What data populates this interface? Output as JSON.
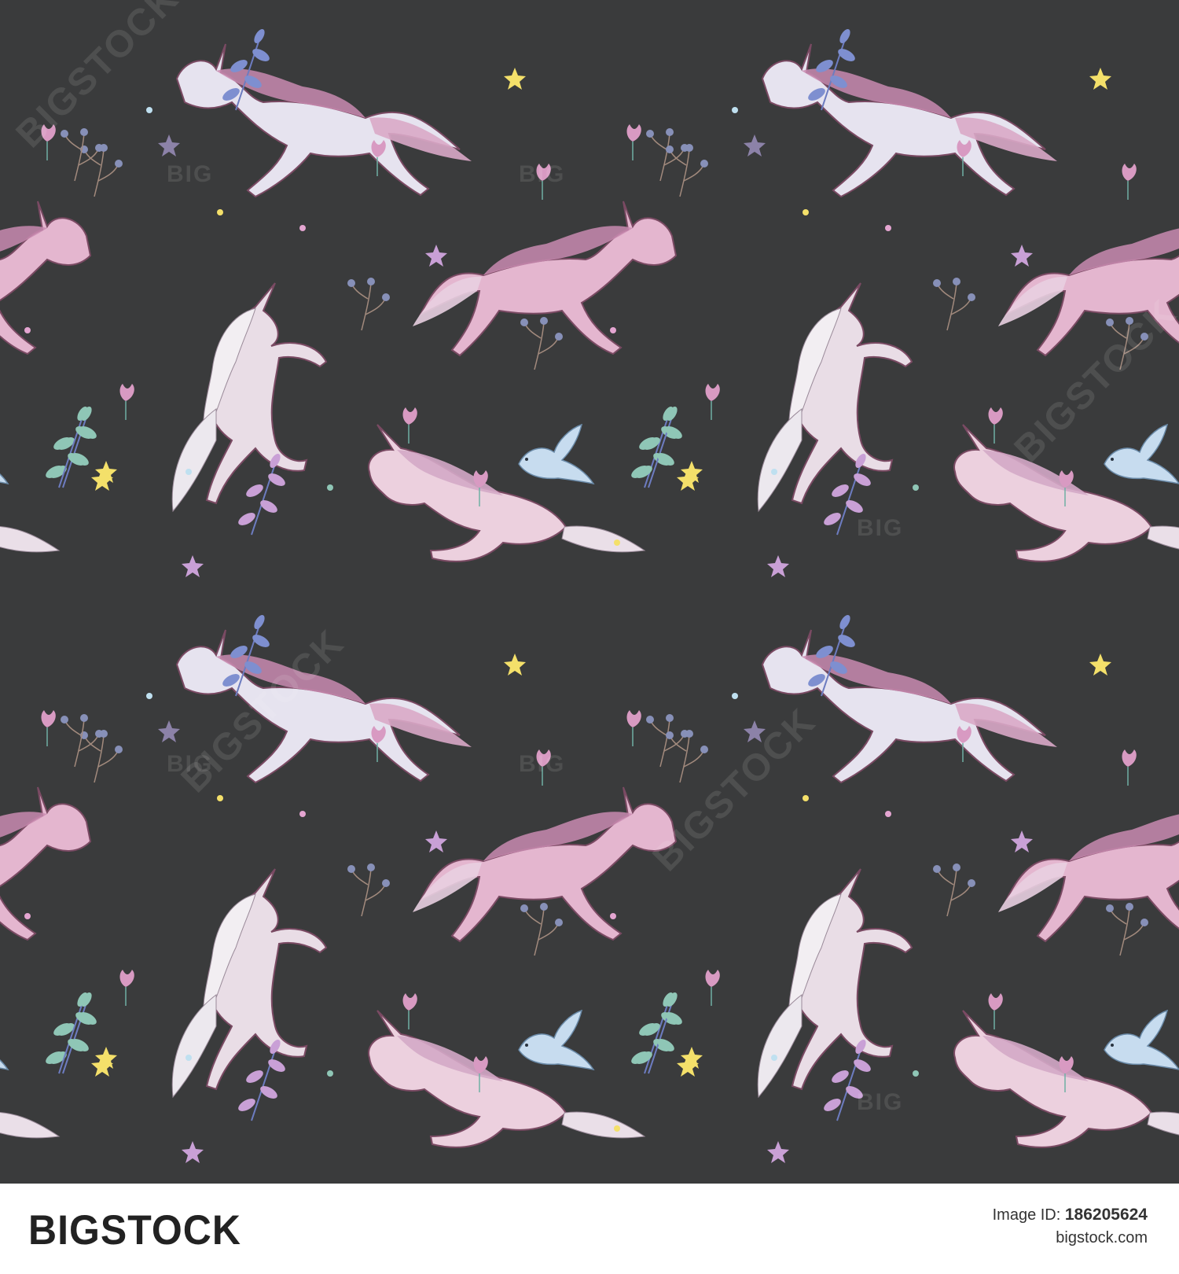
{
  "footer": {
    "logo": "BIGSTOCK",
    "image_id_label": "Image ID: ",
    "image_id": "186205624",
    "site": "bigstock.com"
  },
  "watermarks": {
    "small": "BIG",
    "large": "BIGSTOCK"
  },
  "pattern": {
    "background": "#3a3b3c",
    "motifs": [
      "running-unicorn",
      "rearing-unicorn",
      "leaping-unicorn",
      "dove",
      "star",
      "flower",
      "leafy-sprig",
      "berry-sprig"
    ]
  },
  "colors": {
    "unicorn_white": "#e6e3ef",
    "unicorn_pink": "#e4b6cf",
    "mane_pink": "#c98bb0",
    "star_yellow": "#f4e06a",
    "star_lilac": "#c9a0d6",
    "leaf_blue": "#7e8fd0",
    "leaf_mint": "#8fc6b6",
    "dove_blue": "#c7dcef"
  }
}
